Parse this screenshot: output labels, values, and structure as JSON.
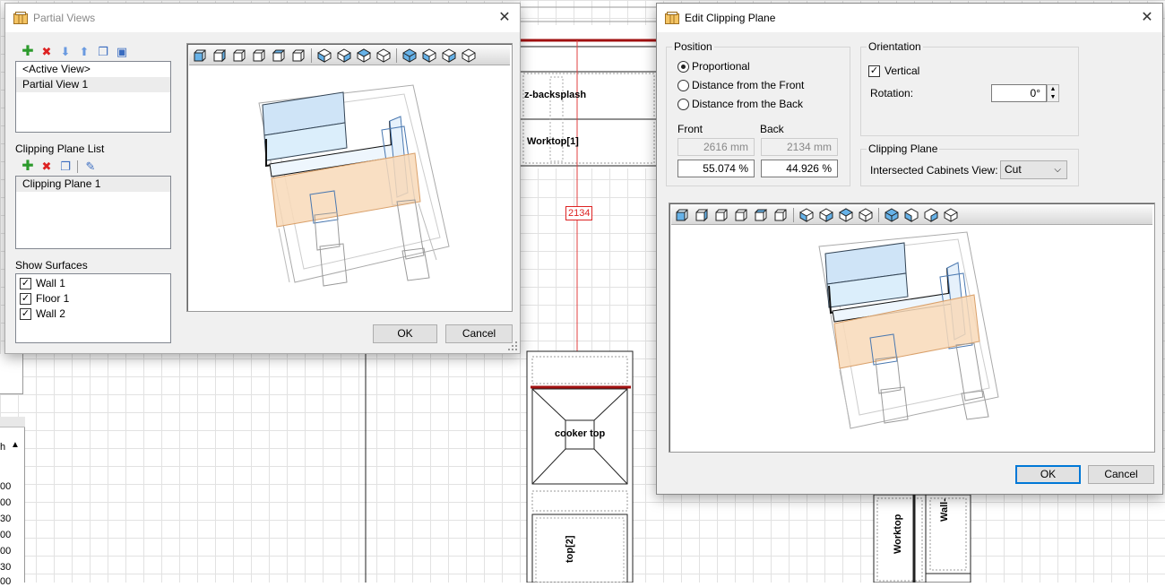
{
  "background": {
    "labels": {
      "backsplash": "z-backsplash",
      "worktop1": "Worktop[1]",
      "dimension": "2134",
      "cooker": "cooker top",
      "worktop2": "top[2]",
      "worktop_right": "Worktop",
      "wall_right": "Wall-"
    },
    "left_strip": {
      "header": "h",
      "numbers": [
        "00",
        "00",
        "30",
        "00",
        "00",
        "30",
        "00"
      ]
    }
  },
  "partial_views": {
    "title": "Partial Views",
    "close_glyph": "✕",
    "views": [
      "<Active View>",
      "Partial View 1"
    ],
    "clipping_plane_list_label": "Clipping Plane List",
    "clipping_planes": [
      "Clipping Plane 1"
    ],
    "show_surfaces_label": "Show Surfaces",
    "surfaces": [
      {
        "label": "Wall 1",
        "checked": true
      },
      {
        "label": "Floor 1",
        "checked": true
      },
      {
        "label": "Wall 2",
        "checked": true
      }
    ],
    "ok_label": "OK",
    "cancel_label": "Cancel"
  },
  "edit_clipping_plane": {
    "title": "Edit Clipping Plane",
    "close_glyph": "✕",
    "position": {
      "group_label": "Position",
      "options": [
        "Proportional",
        "Distance from the Front",
        "Distance from the Back"
      ],
      "selected": 0,
      "front_label": "Front",
      "back_label": "Back",
      "front_mm": "2616 mm",
      "back_mm": "2134 mm",
      "front_pct": "55.074 %",
      "back_pct": "44.926 %"
    },
    "orientation": {
      "group_label": "Orientation",
      "vertical_label": "Vertical",
      "vertical_checked": true,
      "rotation_label": "Rotation:",
      "rotation_value": "0°"
    },
    "clipping_plane": {
      "group_label": "Clipping Plane",
      "intersected_label": "Intersected Cabinets View:",
      "intersected_value": "Cut"
    },
    "ok_label": "OK",
    "cancel_label": "Cancel"
  },
  "colors": {
    "accent": "#0078d7",
    "plane_fill": "#f8d9b8",
    "cabinet_blue": "#cfe4f7",
    "wall_red": "#a01010"
  }
}
